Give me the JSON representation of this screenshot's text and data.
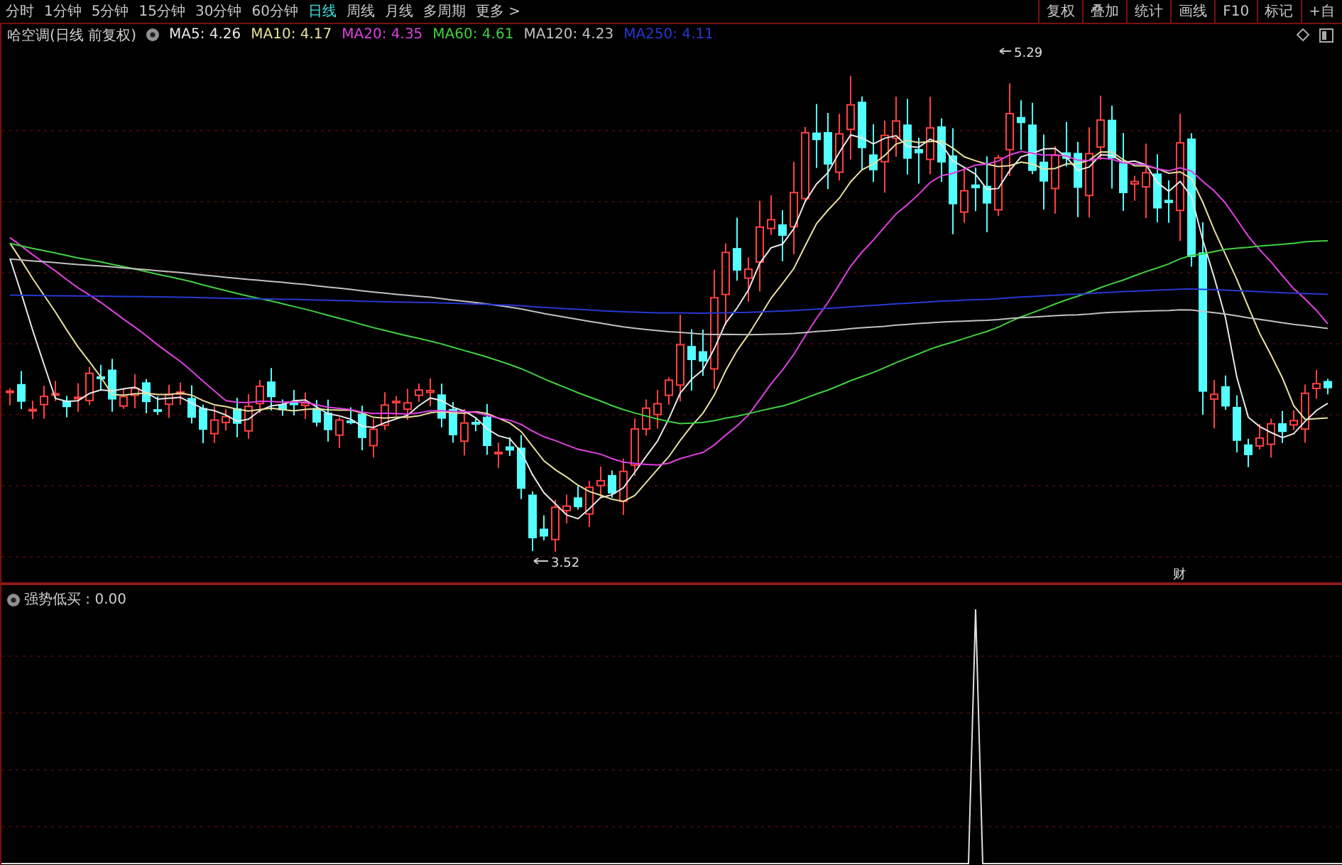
{
  "period_tabs": [
    {
      "label": "分时",
      "selected": false
    },
    {
      "label": "1分钟",
      "selected": false
    },
    {
      "label": "5分钟",
      "selected": false
    },
    {
      "label": "15分钟",
      "selected": false
    },
    {
      "label": "30分钟",
      "selected": false
    },
    {
      "label": "60分钟",
      "selected": false
    },
    {
      "label": "日线",
      "selected": true
    },
    {
      "label": "周线",
      "selected": false
    },
    {
      "label": "月线",
      "selected": false
    },
    {
      "label": "多周期",
      "selected": false
    },
    {
      "label": "更多 >",
      "selected": false
    }
  ],
  "toolbar_buttons": [
    "复权",
    "叠加",
    "统计",
    "画线",
    "F10",
    "标记",
    "+自"
  ],
  "main_chart": {
    "title": "哈空调(日线 前复权)",
    "ma_legend": [
      {
        "label": "MA5: 4.26",
        "color": "#e8e8e8"
      },
      {
        "label": "MA10: 4.17",
        "color": "#e8e0a0"
      },
      {
        "label": "MA20: 4.35",
        "color": "#e040e0"
      },
      {
        "label": "MA60: 4.61",
        "color": "#40d040"
      },
      {
        "label": "MA120: 4.23",
        "color": "#c0c0c0"
      },
      {
        "label": "MA250: 4.11",
        "color": "#2838d0"
      }
    ],
    "high_label": "5.29",
    "low_label": "3.52",
    "marker_label": "财"
  },
  "indicator_panel": {
    "label": "强势低买 : 0.00"
  }
}
